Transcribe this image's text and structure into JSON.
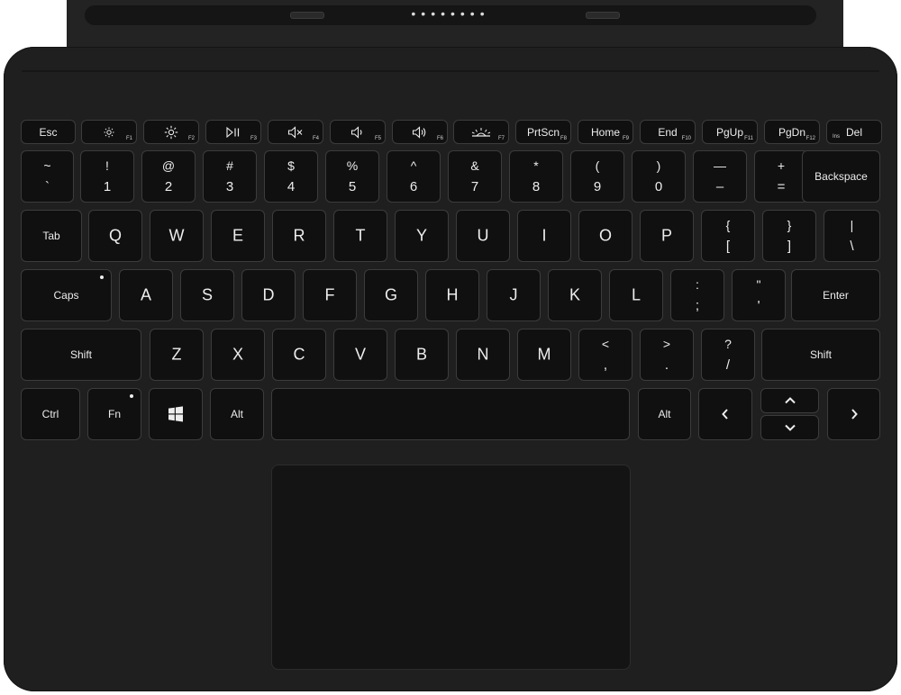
{
  "colors": {
    "body": "#1f1f1f",
    "key": "#101010",
    "key_border": "#3c3c3c",
    "legend": "#ededed",
    "background": "#ffffff"
  },
  "hinge": {
    "dots": "••••••••"
  },
  "function_row": [
    {
      "id": "esc",
      "label": "Esc"
    },
    {
      "id": "f1",
      "icon": "brightness-down-icon",
      "fn": "F1"
    },
    {
      "id": "f2",
      "icon": "brightness-up-icon",
      "fn": "F2"
    },
    {
      "id": "f3",
      "icon": "play-pause-icon",
      "fn": "F3"
    },
    {
      "id": "f4",
      "icon": "mute-icon",
      "fn": "F4"
    },
    {
      "id": "f5",
      "icon": "volume-down-icon",
      "fn": "F5"
    },
    {
      "id": "f6",
      "icon": "volume-up-icon",
      "fn": "F6"
    },
    {
      "id": "f7",
      "icon": "backlight-icon",
      "fn": "F7"
    },
    {
      "id": "prtscn",
      "label": "PrtScn",
      "fn": "F8"
    },
    {
      "id": "home",
      "label": "Home",
      "fn": "F9"
    },
    {
      "id": "end",
      "label": "End",
      "fn": "F10"
    },
    {
      "id": "pgup",
      "label": "PgUp",
      "fn": "F11"
    },
    {
      "id": "pgdn",
      "label": "PgDn",
      "fn": "F12"
    },
    {
      "id": "del",
      "label": "Del",
      "sub": "Ins"
    }
  ],
  "number_row": [
    {
      "id": "backtick",
      "upper": "~",
      "lower": "`"
    },
    {
      "id": "1",
      "upper": "!",
      "lower": "1"
    },
    {
      "id": "2",
      "upper": "@",
      "lower": "2"
    },
    {
      "id": "3",
      "upper": "#",
      "lower": "3"
    },
    {
      "id": "4",
      "upper": "$",
      "lower": "4"
    },
    {
      "id": "5",
      "upper": "%",
      "lower": "5"
    },
    {
      "id": "6",
      "upper": "^",
      "lower": "6"
    },
    {
      "id": "7",
      "upper": "&",
      "lower": "7"
    },
    {
      "id": "8",
      "upper": "*",
      "lower": "8"
    },
    {
      "id": "9",
      "upper": "(",
      "lower": "9"
    },
    {
      "id": "0",
      "upper": ")",
      "lower": "0"
    },
    {
      "id": "minus",
      "upper": "—",
      "lower": "–"
    },
    {
      "id": "equals",
      "upper": "+",
      "lower": "="
    },
    {
      "id": "backspace",
      "label": "Backspace"
    }
  ],
  "top_row": [
    {
      "id": "tab",
      "label": "Tab"
    },
    {
      "id": "q",
      "big": "Q"
    },
    {
      "id": "w",
      "big": "W"
    },
    {
      "id": "e",
      "big": "E"
    },
    {
      "id": "r",
      "big": "R"
    },
    {
      "id": "t",
      "big": "T"
    },
    {
      "id": "y",
      "big": "Y"
    },
    {
      "id": "u",
      "big": "U"
    },
    {
      "id": "i",
      "big": "I"
    },
    {
      "id": "o",
      "big": "O"
    },
    {
      "id": "p",
      "big": "P"
    },
    {
      "id": "lbracket",
      "upper": "{",
      "lower": "["
    },
    {
      "id": "rbracket",
      "upper": "}",
      "lower": "]"
    },
    {
      "id": "backslash",
      "upper": "|",
      "lower": "\\"
    }
  ],
  "home_row": [
    {
      "id": "caps",
      "label": "Caps"
    },
    {
      "id": "a",
      "big": "A"
    },
    {
      "id": "s",
      "big": "S"
    },
    {
      "id": "d",
      "big": "D"
    },
    {
      "id": "f",
      "big": "F"
    },
    {
      "id": "g",
      "big": "G"
    },
    {
      "id": "h",
      "big": "H"
    },
    {
      "id": "j",
      "big": "J"
    },
    {
      "id": "k",
      "big": "K"
    },
    {
      "id": "l",
      "big": "L"
    },
    {
      "id": "semicolon",
      "upper": ":",
      "lower": ";"
    },
    {
      "id": "quote",
      "upper": "\"",
      "lower": "'"
    },
    {
      "id": "enter",
      "label": "Enter"
    }
  ],
  "bottom_row": [
    {
      "id": "lshift",
      "label": "Shift"
    },
    {
      "id": "z",
      "big": "Z"
    },
    {
      "id": "x",
      "big": "X"
    },
    {
      "id": "c",
      "big": "C"
    },
    {
      "id": "v",
      "big": "V"
    },
    {
      "id": "b",
      "big": "B"
    },
    {
      "id": "n",
      "big": "N"
    },
    {
      "id": "m",
      "big": "M"
    },
    {
      "id": "comma",
      "upper": "<",
      "lower": ","
    },
    {
      "id": "period",
      "upper": ">",
      "lower": "."
    },
    {
      "id": "slash",
      "upper": "?",
      "lower": "/"
    },
    {
      "id": "rshift",
      "label": "Shift"
    }
  ],
  "space_row": [
    {
      "id": "ctrl",
      "label": "Ctrl"
    },
    {
      "id": "fn",
      "label": "Fn"
    },
    {
      "id": "win",
      "icon": "windows-logo-icon"
    },
    {
      "id": "lalt",
      "label": "Alt"
    },
    {
      "id": "space",
      "label": ""
    },
    {
      "id": "ralt",
      "label": "Alt"
    },
    {
      "id": "left",
      "arrow": "‹",
      "icon": "arrow-left-icon"
    },
    {
      "id": "up",
      "arrow": "⌃",
      "icon": "arrow-up-icon"
    },
    {
      "id": "down",
      "arrow": "⌄",
      "icon": "arrow-down-icon"
    },
    {
      "id": "right",
      "arrow": "›",
      "icon": "arrow-right-icon"
    }
  ]
}
